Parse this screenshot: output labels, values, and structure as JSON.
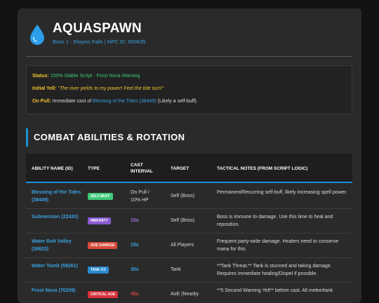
{
  "boss": {
    "name": "AQUASPAWN",
    "subtitle": "Boss 1 - Elwynn Falls | NPC ID: 600635",
    "icon": "water-drop-icon",
    "icon_color": "#2a9ee8"
  },
  "info": {
    "status_label": "Status:",
    "status_value": "100% Stable Script - Frost Nova Warning",
    "yell_label": "Initial Yell:",
    "yell_value": "\"The river yields to my power! Feel the tide turn!\"",
    "pull_label": "On Pull:",
    "pull_prefix": "Immediate cast of",
    "pull_spell": "Blessing of the Tides (38449)",
    "pull_suffix": "(Likely a self-buff)."
  },
  "section": {
    "title": "COMBAT ABILITIES & ROTATION"
  },
  "table": {
    "headers": {
      "ability": "ABILITY NAME (ID)",
      "type": "TYPE",
      "cast": "CAST INTERVAL",
      "target": "TARGET",
      "notes": "TACTICAL NOTES (FROM SCRIPT LOGIC)"
    },
    "rows": [
      {
        "ability": "Blessing of the Tides (38449)",
        "type": "SELF-BUFF",
        "type_color": "#3fca78",
        "cast": "On Pull / 10% HP",
        "cast_color": "#dcdcdc",
        "target": "Self (Boss)",
        "notes": "Permanent/Recurring self-buff, likely increasing spell power."
      },
      {
        "ability": "Submersion (22420)",
        "type": "IMMUNITY",
        "type_color": "#8a5ad0",
        "cast": "15s",
        "cast_color": "#a070e0",
        "target": "Self (Boss)",
        "notes": "Boss is immune to damage. Use this time to heal and reposition."
      },
      {
        "ability": "Water Bolt Volley (38623)",
        "type": "AOE DAMAGE",
        "type_color": "#d84a3a",
        "cast": "18s",
        "cast_color": "#3aa0e0",
        "target": "All Players",
        "notes": "Frequent party-wide damage. Healers need to conserve mana for this."
      },
      {
        "ability": "Water Tomb (59261)",
        "type": "TANK CC",
        "type_color": "#2a8ad0",
        "cast": "30s",
        "cast_color": "#3aa0e0",
        "target": "Tank",
        "notes": "**Tank Threat.** Tank is stunned and taking damage. Requires immediate healing/Dispel if possible."
      },
      {
        "ability": "Frost Nova (70209)",
        "type": "CRITICAL AOE",
        "type_color": "#d8303a",
        "cast": "45s",
        "cast_color": "#e04040",
        "target": "AoE (Nearby",
        "notes": "**5 Second Warning Yell** before cast. All melee/tank"
      }
    ]
  }
}
